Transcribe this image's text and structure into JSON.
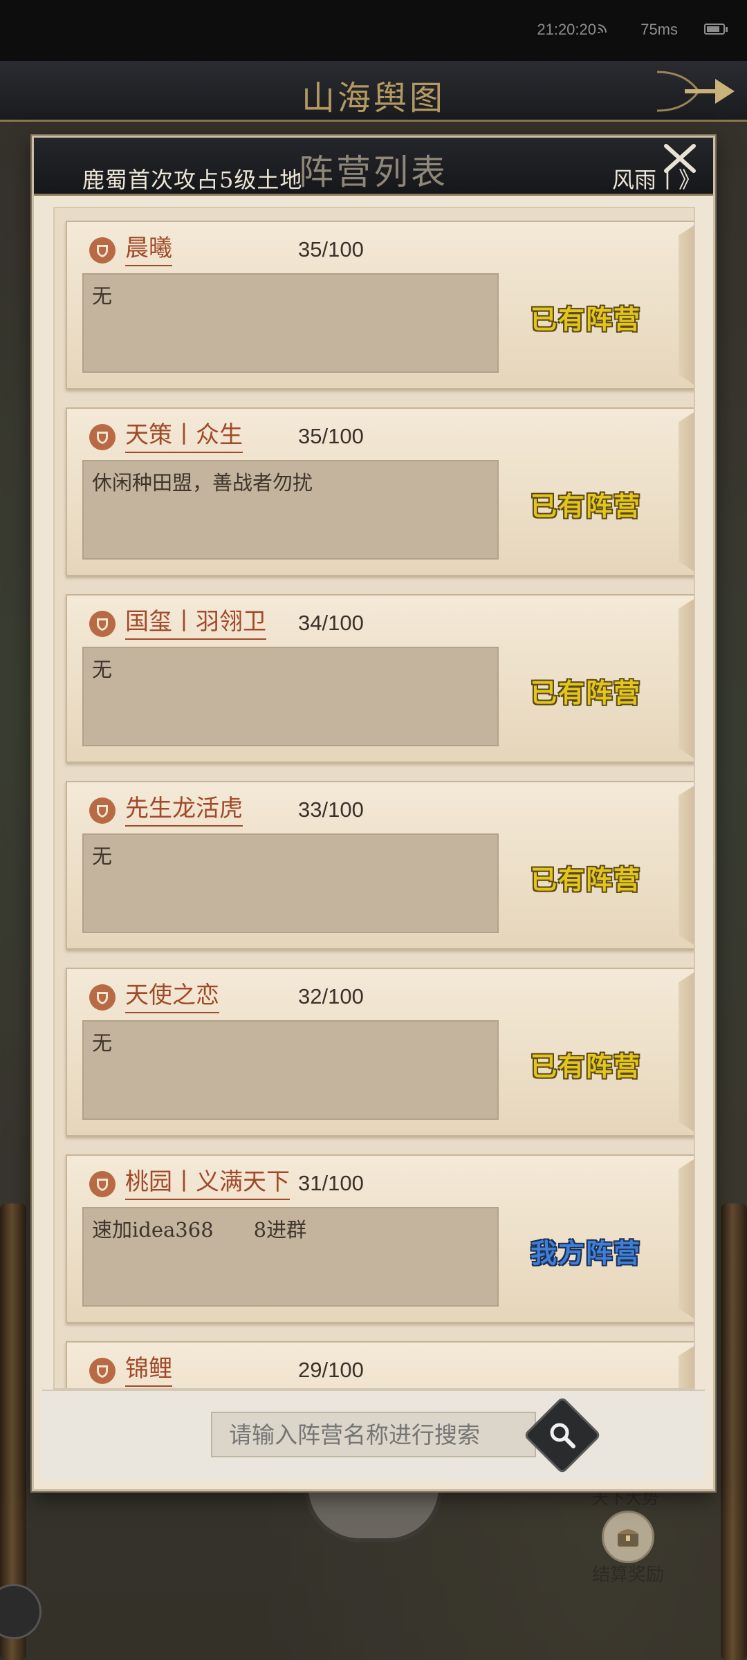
{
  "status_bar": {
    "time": "21:20:20",
    "latency": "75ms"
  },
  "title_bar": {
    "title": "山海舆图"
  },
  "panel": {
    "title": "阵营列表",
    "notice": "鹿蜀首次攻占5级土地",
    "notice_right": "风雨丨》"
  },
  "camps": [
    {
      "name": "晨曦",
      "count": "35/100",
      "desc": "无",
      "status": "已有阵营",
      "status_type": "have"
    },
    {
      "name": "天策丨众生",
      "count": "35/100",
      "desc": "休闲种田盟，善战者勿扰",
      "status": "已有阵营",
      "status_type": "have"
    },
    {
      "name": "国玺丨羽翎卫",
      "count": "34/100",
      "desc": "无",
      "status": "已有阵营",
      "status_type": "have"
    },
    {
      "name": "先生龙活虎",
      "count": "33/100",
      "desc": "无",
      "status": "已有阵营",
      "status_type": "have"
    },
    {
      "name": "天使之恋",
      "count": "32/100",
      "desc": "无",
      "status": "已有阵营",
      "status_type": "have"
    },
    {
      "name": "桃园丨义满天下",
      "count": "31/100",
      "desc": "速加idea368　　8进群",
      "status": "我方阵营",
      "status_type": "mine"
    },
    {
      "name": "锦鲤",
      "count": "29/100",
      "desc": "",
      "status": "",
      "status_type": "have"
    }
  ],
  "search": {
    "placeholder": "请输入阵营名称进行搜索"
  },
  "reward": {
    "top_label": "天下大势",
    "label": "结算奖励"
  },
  "colors": {
    "status_have": "#e3c51d",
    "status_mine": "#3f7fd6",
    "name_color": "#a04a28"
  }
}
